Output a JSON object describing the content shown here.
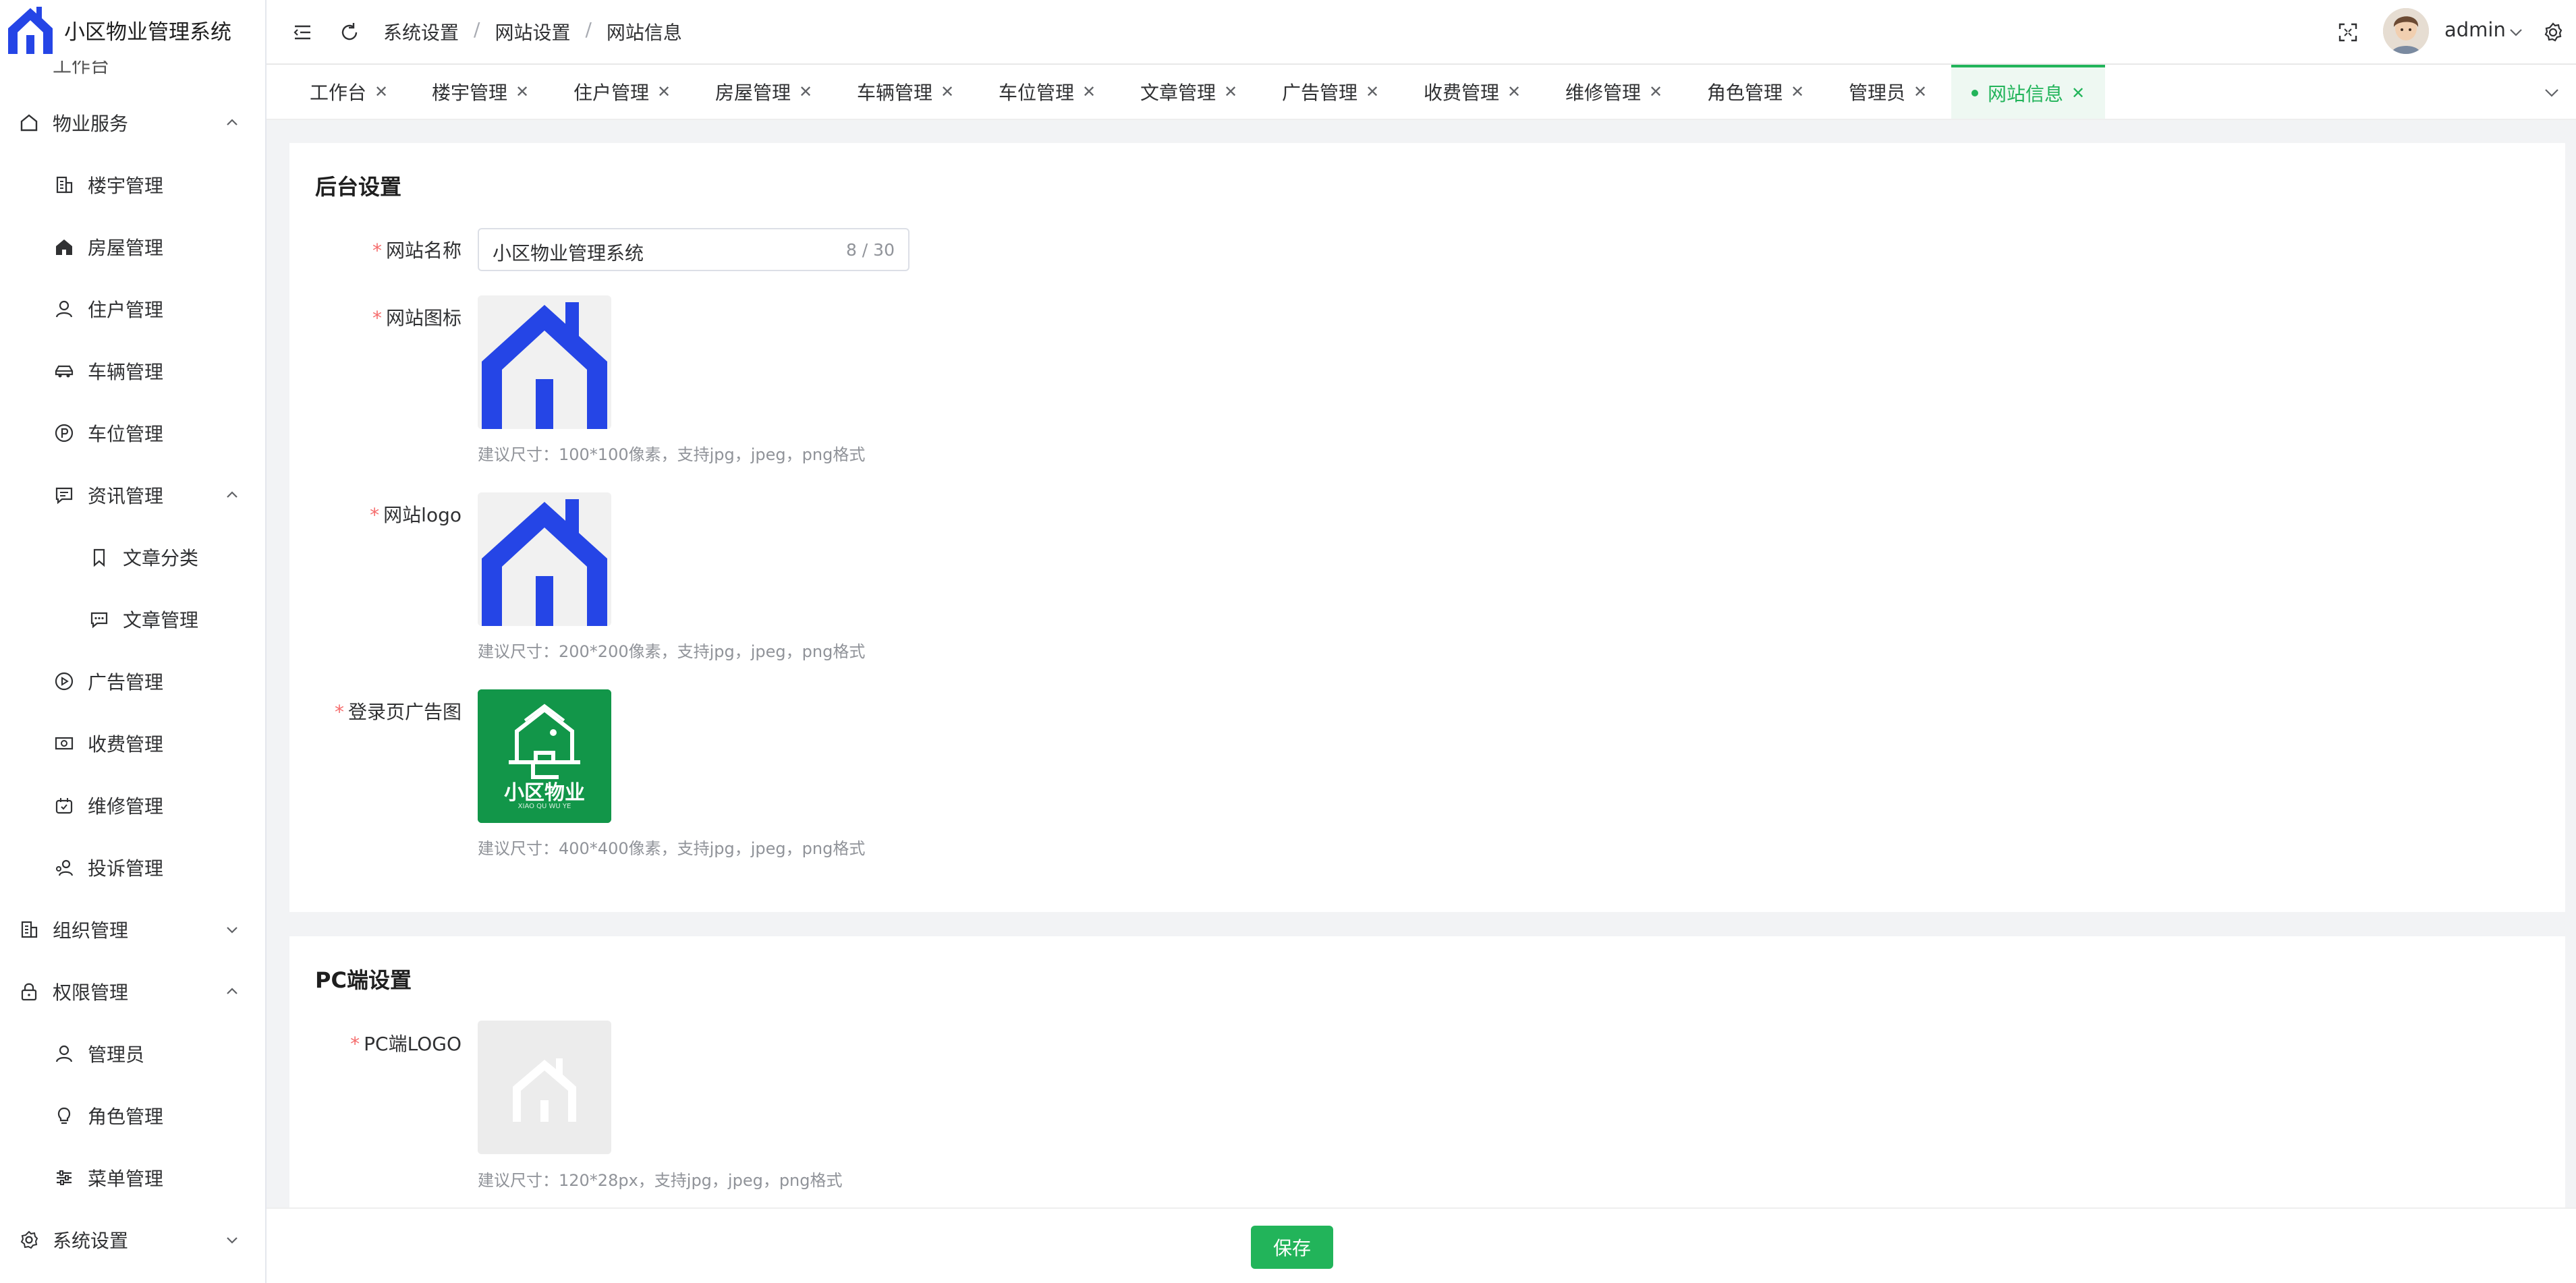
{
  "app": {
    "title": "小区物业管理系统",
    "brand_color": "#2545e6",
    "accent_color": "#22b45a"
  },
  "sidebar": {
    "partial_item": "工作台",
    "items": [
      {
        "label": "物业服务",
        "icon": "home-outline-icon",
        "level": 1,
        "expanded": true
      },
      {
        "label": "楼宇管理",
        "icon": "building-icon",
        "level": 2
      },
      {
        "label": "房屋管理",
        "icon": "house-filled-icon",
        "level": 2,
        "active": true
      },
      {
        "label": "住户管理",
        "icon": "user-icon",
        "level": 2
      },
      {
        "label": "车辆管理",
        "icon": "car-icon",
        "level": 2
      },
      {
        "label": "车位管理",
        "icon": "parking-icon",
        "level": 2
      },
      {
        "label": "资讯管理",
        "icon": "message-icon",
        "level": 2,
        "expanded": true
      },
      {
        "label": "文章分类",
        "icon": "bookmark-icon",
        "level": 3
      },
      {
        "label": "文章管理",
        "icon": "chat-icon",
        "level": 3
      },
      {
        "label": "广告管理",
        "icon": "play-circle-icon",
        "level": 2
      },
      {
        "label": "收费管理",
        "icon": "money-icon",
        "level": 2
      },
      {
        "label": "维修管理",
        "icon": "repair-icon",
        "level": 2
      },
      {
        "label": "投诉管理",
        "icon": "complaint-icon",
        "level": 2
      },
      {
        "label": "组织管理",
        "icon": "office-icon",
        "level": 1,
        "expanded": false
      },
      {
        "label": "权限管理",
        "icon": "lock-icon",
        "level": 1,
        "expanded": true
      },
      {
        "label": "管理员",
        "icon": "user-icon",
        "level": 2
      },
      {
        "label": "角色管理",
        "icon": "bulb-icon",
        "level": 2
      },
      {
        "label": "菜单管理",
        "icon": "sliders-icon",
        "level": 2
      },
      {
        "label": "系统设置",
        "icon": "gear-icon",
        "level": 1,
        "expanded": false
      }
    ]
  },
  "header": {
    "breadcrumb": [
      "系统设置",
      "网站设置",
      "网站信息"
    ],
    "separator": "/",
    "username": "admin"
  },
  "tabs": [
    {
      "label": "工作台"
    },
    {
      "label": "楼宇管理"
    },
    {
      "label": "住户管理"
    },
    {
      "label": "房屋管理"
    },
    {
      "label": "车辆管理"
    },
    {
      "label": "车位管理"
    },
    {
      "label": "文章管理"
    },
    {
      "label": "广告管理"
    },
    {
      "label": "收费管理"
    },
    {
      "label": "维修管理"
    },
    {
      "label": "角色管理"
    },
    {
      "label": "管理员"
    },
    {
      "label": "网站信息",
      "active": true
    }
  ],
  "backend": {
    "title": "后台设置",
    "site_name_label": "网站名称",
    "site_name_value": "小区物业管理系统",
    "site_name_counter": "8 / 30",
    "site_icon_label": "网站图标",
    "site_icon_hint": "建议尺寸：100*100像素，支持jpg，jpeg，png格式",
    "site_logo_label": "网站logo",
    "site_logo_hint": "建议尺寸：200*200像素，支持jpg，jpeg，png格式",
    "login_ad_label": "登录页广告图",
    "login_ad_hint": "建议尺寸：400*400像素，支持jpg，jpeg，png格式",
    "login_ad_text": "小区物业",
    "login_ad_subtext": "XIAO QU WU YE"
  },
  "pc": {
    "title": "PC端设置",
    "logo_label": "PC端LOGO",
    "logo_hint": "建议尺寸：120*28px，支持jpg，jpeg，png格式"
  },
  "footer": {
    "save_label": "保存"
  }
}
